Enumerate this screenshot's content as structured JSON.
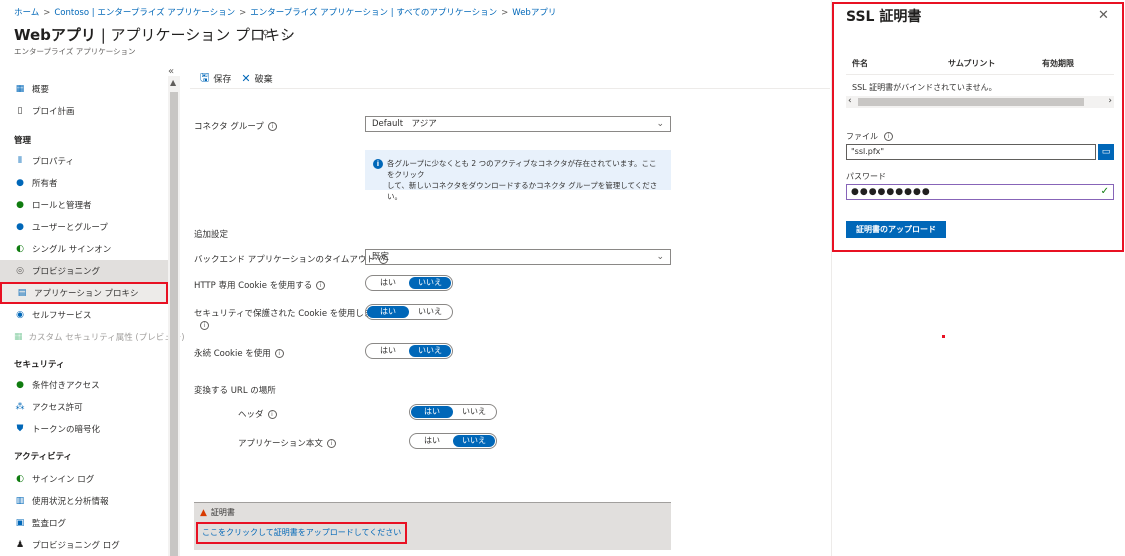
{
  "breadcrumb": [
    "ホーム",
    "Contoso | エンタープライズ アプリケーション",
    "エンタープライズ アプリケーション | すべてのアプリケーション",
    "Webアプリ"
  ],
  "header": {
    "title": "Webアプリ",
    "title_rest": " | アプリケーション プロキシ",
    "pin": "⚲",
    "more": "…",
    "subtitle": "エンタープライズ アプリケーション"
  },
  "sidebar": {
    "collapse": "«",
    "items_top": [
      {
        "label": "概要",
        "icon": "grid-icon"
      },
      {
        "label": "プロイ計画",
        "icon": "book-icon"
      }
    ],
    "section_manage": "管理",
    "items_manage": [
      {
        "label": "プロパティ"
      },
      {
        "label": "所有者"
      },
      {
        "label": "ロールと管理者"
      },
      {
        "label": "ユーザーとグループ"
      },
      {
        "label": "シングル サインオン"
      },
      {
        "label": "プロビジョニング"
      },
      {
        "label": "アプリケーション プロキシ"
      },
      {
        "label": "セルフサービス"
      },
      {
        "label": "カスタム セキュリティ属性 (プレビュー)"
      }
    ],
    "section_security": "セキュリティ",
    "items_security": [
      {
        "label": "条件付きアクセス"
      },
      {
        "label": "アクセス許可"
      },
      {
        "label": "トークンの暗号化"
      }
    ],
    "section_activity": "アクティビティ",
    "items_activity": [
      {
        "label": "サインイン ログ"
      },
      {
        "label": "使用状況と分析情報"
      },
      {
        "label": "監査ログ"
      },
      {
        "label": "プロビジョニング ログ"
      }
    ]
  },
  "toolbar": {
    "save": "保存",
    "discard": "破棄"
  },
  "form": {
    "connector_group_label": "コネクタ グループ",
    "connector_group_value": "Default　アジア",
    "info_text_1": "各グループに少なくとも 2 つのアクティブなコネクタが存在されています。ここをクリック",
    "info_text_2": "して、新しいコネクタをダウンロードするかコネクタ グループを管理してください。",
    "additional_settings": "追加設定",
    "timeout_label": "バックエンド アプリケーションのタイムアウト",
    "timeout_value": "既定",
    "http_cookie_label": "HTTP 専用 Cookie を使用する",
    "secure_cookie_label": "セキュリティで保護された Cookie を使用します",
    "persistent_cookie_label": "永続 Cookie を使用",
    "translate_url_label": "変換する URL の場所",
    "headers_label": "ヘッダ",
    "app_body_label": "アプリケーション本文",
    "yes": "はい",
    "no": "いいえ",
    "cert_warning": "証明書",
    "cert_link": "ここをクリックして証明書をアップロードしてください"
  },
  "panel": {
    "title": "SSL 証明書",
    "close": "✕",
    "col_subject": "件名",
    "col_thumbprint": "サムプリント",
    "col_expiry": "有効期限",
    "empty": "SSL 証明書がバインドされていません。",
    "file_label": "ファイル",
    "file_value": "\"ssl.pfx\"",
    "password_label": "パスワード",
    "password_value": "●●●●●●●●●",
    "upload": "証明書のアップロード"
  },
  "colors": {
    "accent": "#0067b8",
    "highlight": "#e81123"
  }
}
